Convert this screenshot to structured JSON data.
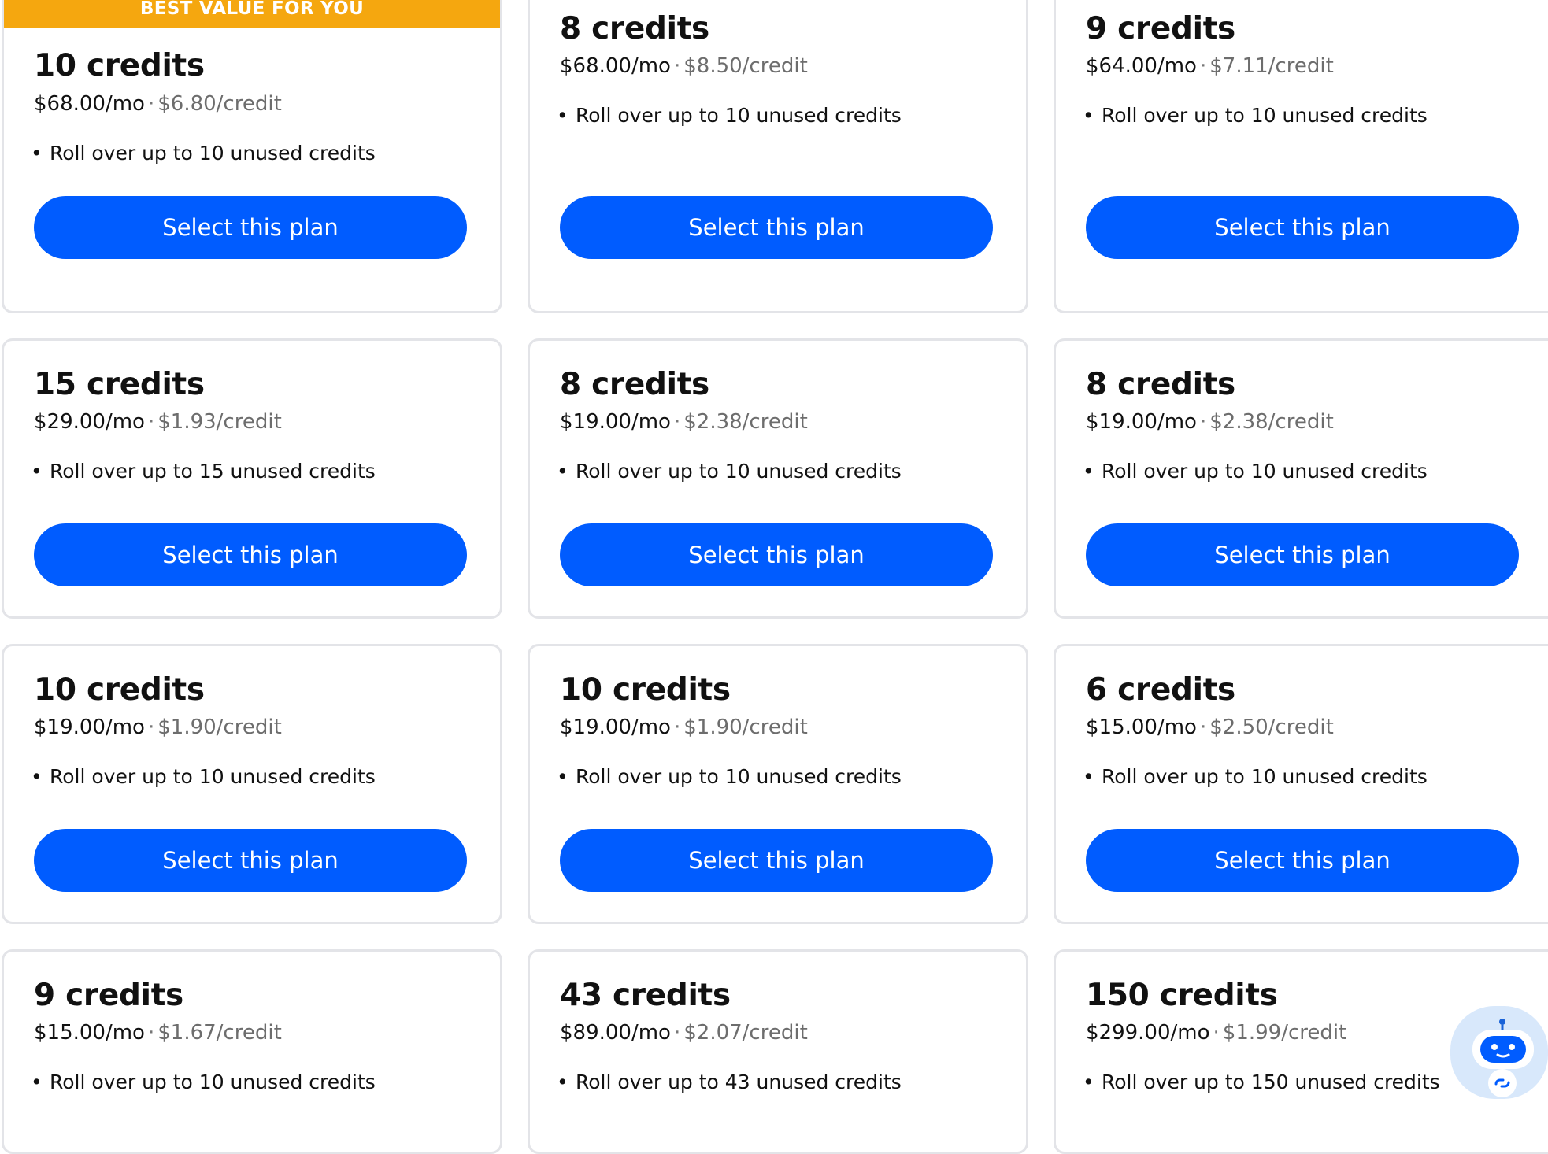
{
  "best_value_badge": "BEST VALUE FOR YOU",
  "plans": [
    {
      "credits": "10 credits",
      "price": "$68.00/mo",
      "per_credit": "$6.80/credit",
      "feature": "Roll over up to 10 unused credits",
      "button": "Select this plan"
    },
    {
      "credits": "8 credits",
      "price": "$68.00/mo",
      "per_credit": "$8.50/credit",
      "feature": "Roll over up to 10 unused credits",
      "button": "Select this plan"
    },
    {
      "credits": "9 credits",
      "price": "$64.00/mo",
      "per_credit": "$7.11/credit",
      "feature": "Roll over up to 10 unused credits",
      "button": "Select this plan"
    },
    {
      "credits": "15 credits",
      "price": "$29.00/mo",
      "per_credit": "$1.93/credit",
      "feature": "Roll over up to 15 unused credits",
      "button": "Select this plan"
    },
    {
      "credits": "8 credits",
      "price": "$19.00/mo",
      "per_credit": "$2.38/credit",
      "feature": "Roll over up to 10 unused credits",
      "button": "Select this plan"
    },
    {
      "credits": "8 credits",
      "price": "$19.00/mo",
      "per_credit": "$2.38/credit",
      "feature": "Roll over up to 10 unused credits",
      "button": "Select this plan"
    },
    {
      "credits": "10 credits",
      "price": "$19.00/mo",
      "per_credit": "$1.90/credit",
      "feature": "Roll over up to 10 unused credits",
      "button": "Select this plan"
    },
    {
      "credits": "10 credits",
      "price": "$19.00/mo",
      "per_credit": "$1.90/credit",
      "feature": "Roll over up to 10 unused credits",
      "button": "Select this plan"
    },
    {
      "credits": "6 credits",
      "price": "$15.00/mo",
      "per_credit": "$2.50/credit",
      "feature": "Roll over up to 10 unused credits",
      "button": "Select this plan"
    },
    {
      "credits": "9 credits",
      "price": "$15.00/mo",
      "per_credit": "$1.67/credit",
      "feature": "Roll over up to 10 unused credits"
    },
    {
      "credits": "43 credits",
      "price": "$89.00/mo",
      "per_credit": "$2.07/credit",
      "feature": "Roll over up to 43 unused credits"
    },
    {
      "credits": "150 credits",
      "price": "$299.00/mo",
      "per_credit": "$1.99/credit",
      "feature": "Roll over up to 150 unused credits"
    }
  ],
  "separator": "·",
  "chat_assistant": {
    "icon": "robot-icon"
  },
  "colors": {
    "accent_blue": "#005cff",
    "badge_orange": "#f5a70f",
    "card_border": "#e3e4e8",
    "muted_text": "#6d6d6d"
  }
}
